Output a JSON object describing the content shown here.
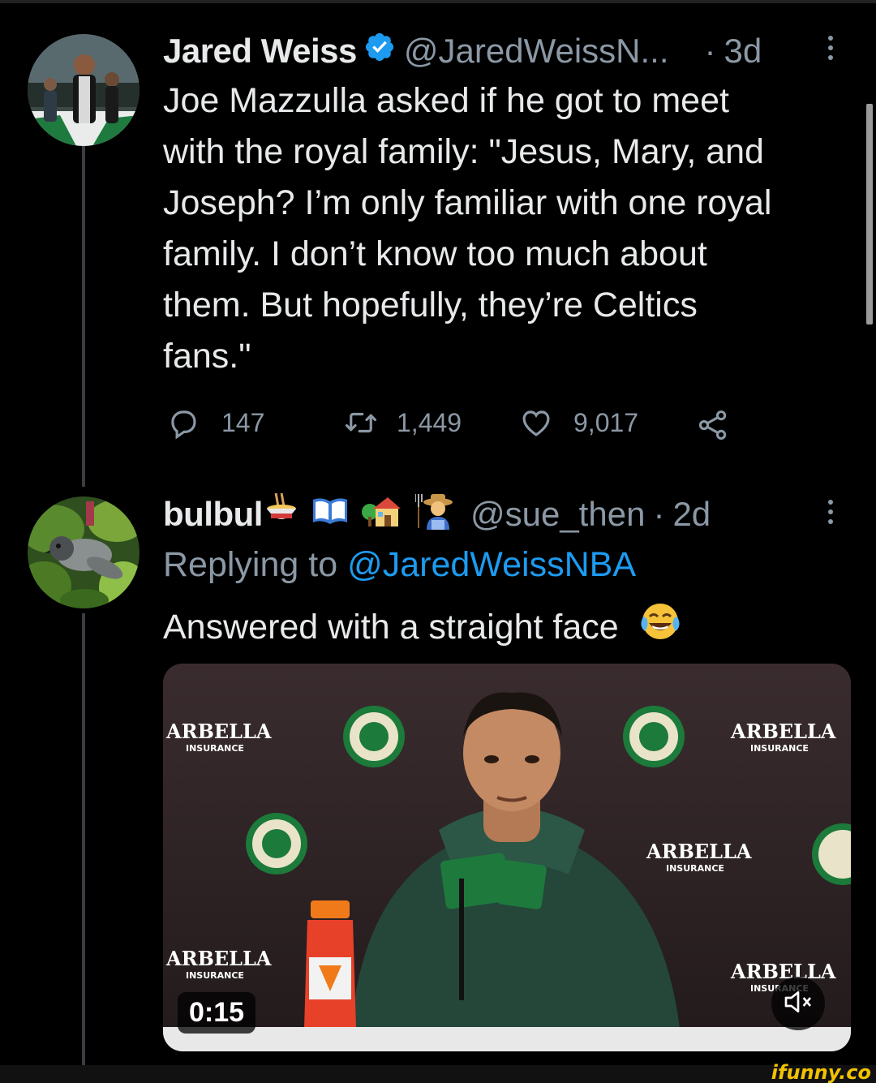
{
  "tweet1": {
    "display_name": "Jared Weiss",
    "handle": "@JaredWeissN...",
    "separator": "·",
    "time": "3d",
    "text_lines": [
      "Joe Mazzulla asked if he got to meet",
      "with the royal family: \"Jesus, Mary, and",
      "Joseph? I’m only familiar with one royal",
      "family. I don’t know too much about",
      "them. But hopefully, they’re Celtics",
      "fans.\""
    ],
    "stats": {
      "replies": "147",
      "retweets": "1,449",
      "likes": "9,017"
    },
    "icons": {
      "verified": "verified-badge-icon",
      "reply": "comment-icon",
      "retweet": "retweet-icon",
      "like": "heart-icon",
      "share": "share-icon"
    }
  },
  "tweet2": {
    "display_name": "bulbul",
    "name_emojis": [
      "ramen-bowl",
      "open-book",
      "house-with-garden",
      "farmer"
    ],
    "handle": "@sue_then",
    "separator": "·",
    "time": "2d",
    "replying_prefix": "Replying to",
    "replying_mention": "@JaredWeissNBA",
    "text": "Answered with a straight face",
    "text_emoji": "face-with-tears-of-joy",
    "video": {
      "duration": "0:15",
      "muted": true,
      "backdrop_text": [
        "ARBELLA",
        "INSURANCE"
      ]
    }
  },
  "watermark": "ifunny.co",
  "colors": {
    "background": "#000000",
    "text": "#e7e9ea",
    "muted": "#8b98a5",
    "link": "#1d9bf0",
    "verified": "#1d9bf0"
  }
}
